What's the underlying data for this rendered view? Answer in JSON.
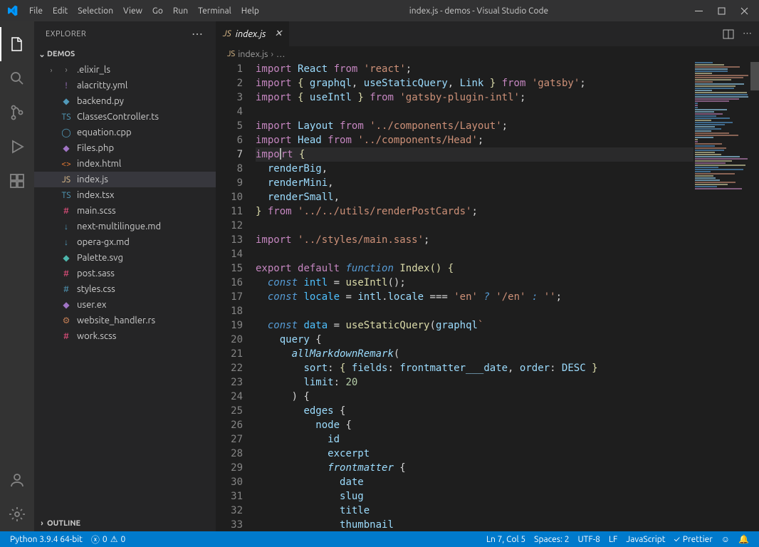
{
  "title": "index.js - demos - Visual Studio Code",
  "menu": [
    "File",
    "Edit",
    "Selection",
    "View",
    "Go",
    "Run",
    "Terminal",
    "Help"
  ],
  "explorer": {
    "header": "EXPLORER",
    "folder": "DEMOS",
    "outline": "OUTLINE",
    "files": [
      {
        "name": ".elixir_ls",
        "icon": "›",
        "cls": "fi-grey",
        "folder": true
      },
      {
        "name": "alacritty.yml",
        "icon": "!",
        "cls": "fi-purple"
      },
      {
        "name": "backend.py",
        "icon": "◆",
        "cls": "fi-blue"
      },
      {
        "name": "ClassesController.ts",
        "icon": "TS",
        "cls": "fi-blue"
      },
      {
        "name": "equation.cpp",
        "icon": "◯",
        "cls": "fi-blue"
      },
      {
        "name": "Files.php",
        "icon": "◆",
        "cls": "fi-purple"
      },
      {
        "name": "index.html",
        "icon": "<>",
        "cls": "fi-orange"
      },
      {
        "name": "index.js",
        "icon": "JS",
        "cls": "fi-yellow",
        "selected": true
      },
      {
        "name": "index.tsx",
        "icon": "TS",
        "cls": "fi-blue"
      },
      {
        "name": "main.scss",
        "icon": "#",
        "cls": "fi-pink"
      },
      {
        "name": "next-multilingue.md",
        "icon": "↓",
        "cls": "fi-blue"
      },
      {
        "name": "opera-gx.md",
        "icon": "↓",
        "cls": "fi-blue"
      },
      {
        "name": "Palette.svg",
        "icon": "◆",
        "cls": "fi-teal"
      },
      {
        "name": "post.sass",
        "icon": "#",
        "cls": "fi-pink"
      },
      {
        "name": "styles.css",
        "icon": "#",
        "cls": "fi-blue"
      },
      {
        "name": "user.ex",
        "icon": "◆",
        "cls": "fi-purple"
      },
      {
        "name": "website_handler.rs",
        "icon": "⚙",
        "cls": "fi-rust"
      },
      {
        "name": "work.scss",
        "icon": "#",
        "cls": "fi-pink"
      }
    ]
  },
  "tab": {
    "name": "index.js"
  },
  "breadcrumb": {
    "file": "index.js",
    "more": "…"
  },
  "status": {
    "python": "Python 3.9.4 64-bit",
    "errors": "0",
    "warnings": "0",
    "lncol": "Ln 7, Col 5",
    "spaces": "Spaces: 2",
    "encoding": "UTF-8",
    "eol": "LF",
    "lang": "JavaScript",
    "prettier": "Prettier"
  },
  "code": [
    [
      [
        "k-pink",
        "import"
      ],
      [
        "k-white",
        " "
      ],
      [
        "k-lblue",
        "React"
      ],
      [
        "k-white",
        " "
      ],
      [
        "k-pink",
        "from"
      ],
      [
        "k-white",
        " "
      ],
      [
        "k-str",
        "'react'"
      ],
      [
        "k-white",
        ";"
      ]
    ],
    [
      [
        "k-pink",
        "import"
      ],
      [
        "k-white",
        " "
      ],
      [
        "k-fn",
        "{"
      ],
      [
        "k-white",
        " "
      ],
      [
        "k-lblue",
        "graphql"
      ],
      [
        "k-white",
        ", "
      ],
      [
        "k-lblue",
        "useStaticQuery"
      ],
      [
        "k-white",
        ", "
      ],
      [
        "k-lblue",
        "Link"
      ],
      [
        "k-white",
        " "
      ],
      [
        "k-fn",
        "}"
      ],
      [
        "k-white",
        " "
      ],
      [
        "k-pink",
        "from"
      ],
      [
        "k-white",
        " "
      ],
      [
        "k-str",
        "'gatsby'"
      ],
      [
        "k-white",
        ";"
      ]
    ],
    [
      [
        "k-pink",
        "import"
      ],
      [
        "k-white",
        " "
      ],
      [
        "k-fn",
        "{"
      ],
      [
        "k-white",
        " "
      ],
      [
        "k-lblue",
        "useIntl"
      ],
      [
        "k-white",
        " "
      ],
      [
        "k-fn",
        "}"
      ],
      [
        "k-white",
        " "
      ],
      [
        "k-pink",
        "from"
      ],
      [
        "k-white",
        " "
      ],
      [
        "k-str",
        "'gatsby-plugin-intl'"
      ],
      [
        "k-white",
        ";"
      ]
    ],
    [],
    [
      [
        "k-pink",
        "import"
      ],
      [
        "k-white",
        " "
      ],
      [
        "k-lblue",
        "Layout"
      ],
      [
        "k-white",
        " "
      ],
      [
        "k-pink",
        "from"
      ],
      [
        "k-white",
        " "
      ],
      [
        "k-str",
        "'../components/Layout'"
      ],
      [
        "k-white",
        ";"
      ]
    ],
    [
      [
        "k-pink",
        "import"
      ],
      [
        "k-white",
        " "
      ],
      [
        "k-lblue",
        "Head"
      ],
      [
        "k-white",
        " "
      ],
      [
        "k-pink",
        "from"
      ],
      [
        "k-white",
        " "
      ],
      [
        "k-str",
        "'../components/Head'"
      ],
      [
        "k-white",
        ";"
      ]
    ],
    [
      [
        "k-pink",
        "impo"
      ],
      [
        "cursor",
        ""
      ],
      [
        "k-pink",
        "rt"
      ],
      [
        "k-white",
        " "
      ],
      [
        "k-fn",
        "{"
      ]
    ],
    [
      [
        "k-white",
        "  "
      ],
      [
        "k-lblue",
        "renderBig"
      ],
      [
        "k-white",
        ","
      ]
    ],
    [
      [
        "k-white",
        "  "
      ],
      [
        "k-lblue",
        "renderMini"
      ],
      [
        "k-white",
        ","
      ]
    ],
    [
      [
        "k-white",
        "  "
      ],
      [
        "k-lblue",
        "renderSmall"
      ],
      [
        "k-white",
        ","
      ]
    ],
    [
      [
        "k-fn",
        "}"
      ],
      [
        "k-white",
        " "
      ],
      [
        "k-pink",
        "from"
      ],
      [
        "k-white",
        " "
      ],
      [
        "k-str",
        "'../../utils/renderPostCards'"
      ],
      [
        "k-white",
        ";"
      ]
    ],
    [],
    [
      [
        "k-pink",
        "import"
      ],
      [
        "k-white",
        " "
      ],
      [
        "k-str",
        "'../styles/main.sass'"
      ],
      [
        "k-white",
        ";"
      ]
    ],
    [],
    [
      [
        "k-pink",
        "export"
      ],
      [
        "k-white",
        " "
      ],
      [
        "k-pink",
        "default"
      ],
      [
        "k-white",
        " "
      ],
      [
        "k-blue k-ital",
        "function"
      ],
      [
        "k-white",
        " "
      ],
      [
        "k-fn",
        "Index"
      ],
      [
        "k-fn",
        "()"
      ],
      [
        "k-white",
        " "
      ],
      [
        "k-fn",
        "{"
      ]
    ],
    [
      [
        "k-white",
        "  "
      ],
      [
        "k-blue k-ital",
        "const"
      ],
      [
        "k-white",
        " "
      ],
      [
        "k-const",
        "intl"
      ],
      [
        "k-white",
        " "
      ],
      [
        "k-white",
        "="
      ],
      [
        "k-white",
        " "
      ],
      [
        "k-fn",
        "useIntl"
      ],
      [
        "k-white",
        "();"
      ]
    ],
    [
      [
        "k-white",
        "  "
      ],
      [
        "k-blue k-ital",
        "const"
      ],
      [
        "k-white",
        " "
      ],
      [
        "k-const",
        "locale"
      ],
      [
        "k-white",
        " "
      ],
      [
        "k-white",
        "="
      ],
      [
        "k-white",
        " "
      ],
      [
        "k-lblue",
        "intl"
      ],
      [
        "k-white",
        "."
      ],
      [
        "k-lblue",
        "locale"
      ],
      [
        "k-white",
        " "
      ],
      [
        "k-white",
        "==="
      ],
      [
        "k-white",
        " "
      ],
      [
        "k-str",
        "'en'"
      ],
      [
        "k-white",
        " "
      ],
      [
        "k-blue k-ital",
        "?"
      ],
      [
        "k-white",
        " "
      ],
      [
        "k-str",
        "'/en'"
      ],
      [
        "k-white",
        " "
      ],
      [
        "k-blue k-ital",
        ":"
      ],
      [
        "k-white",
        " "
      ],
      [
        "k-str",
        "''"
      ],
      [
        "k-white",
        ";"
      ]
    ],
    [],
    [
      [
        "k-white",
        "  "
      ],
      [
        "k-blue k-ital",
        "const"
      ],
      [
        "k-white",
        " "
      ],
      [
        "k-const",
        "data"
      ],
      [
        "k-white",
        " "
      ],
      [
        "k-white",
        "="
      ],
      [
        "k-white",
        " "
      ],
      [
        "k-fn",
        "useStaticQuery"
      ],
      [
        "k-white",
        "("
      ],
      [
        "k-lblue",
        "graphql"
      ],
      [
        "k-str",
        "`"
      ]
    ],
    [
      [
        "k-white",
        "    "
      ],
      [
        "k-lblue",
        "query"
      ],
      [
        "k-white",
        " {"
      ]
    ],
    [
      [
        "k-white",
        "      "
      ],
      [
        "k-lblue k-ital",
        "allMarkdownRemark"
      ],
      [
        "k-white",
        "("
      ]
    ],
    [
      [
        "k-white",
        "        "
      ],
      [
        "k-lblue",
        "sort"
      ],
      [
        "k-white",
        ": "
      ],
      [
        "k-fn",
        "{"
      ],
      [
        "k-white",
        " "
      ],
      [
        "k-lblue",
        "fields"
      ],
      [
        "k-white",
        ": "
      ],
      [
        "k-lblue",
        "frontmatter___date"
      ],
      [
        "k-white",
        ", "
      ],
      [
        "k-lblue",
        "order"
      ],
      [
        "k-white",
        ": "
      ],
      [
        "k-lblue",
        "DESC"
      ],
      [
        "k-white",
        " "
      ],
      [
        "k-fn",
        "}"
      ]
    ],
    [
      [
        "k-white",
        "        "
      ],
      [
        "k-lblue",
        "limit"
      ],
      [
        "k-white",
        ": "
      ],
      [
        "k-num",
        "20"
      ]
    ],
    [
      [
        "k-white",
        "      ) {"
      ]
    ],
    [
      [
        "k-white",
        "        "
      ],
      [
        "k-lblue",
        "edges"
      ],
      [
        "k-white",
        " {"
      ]
    ],
    [
      [
        "k-white",
        "          "
      ],
      [
        "k-lblue",
        "node"
      ],
      [
        "k-white",
        " {"
      ]
    ],
    [
      [
        "k-white",
        "            "
      ],
      [
        "k-lblue",
        "id"
      ]
    ],
    [
      [
        "k-white",
        "            "
      ],
      [
        "k-lblue",
        "excerpt"
      ]
    ],
    [
      [
        "k-white",
        "            "
      ],
      [
        "k-lblue k-ital",
        "frontmatter"
      ],
      [
        "k-white",
        " {"
      ]
    ],
    [
      [
        "k-white",
        "              "
      ],
      [
        "k-lblue",
        "date"
      ]
    ],
    [
      [
        "k-white",
        "              "
      ],
      [
        "k-lblue",
        "slug"
      ]
    ],
    [
      [
        "k-white",
        "              "
      ],
      [
        "k-lblue",
        "title"
      ]
    ],
    [
      [
        "k-white",
        "              "
      ],
      [
        "k-lblue",
        "thumbnail"
      ]
    ]
  ],
  "highlight_line": 7
}
